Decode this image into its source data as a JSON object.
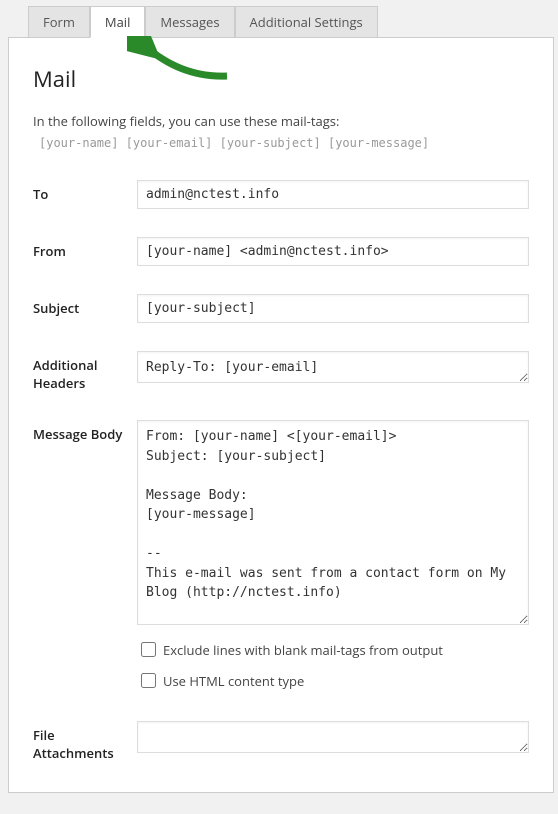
{
  "tabs": {
    "form": "Form",
    "mail": "Mail",
    "messages": "Messages",
    "additional": "Additional Settings"
  },
  "heading": "Mail",
  "intro": "In the following fields, you can use these mail-tags:",
  "mailtags": "[your-name] [your-email] [your-subject] [your-message]",
  "labels": {
    "to": "To",
    "from": "From",
    "subject": "Subject",
    "headers": "Additional Headers",
    "body": "Message Body",
    "attachments": "File Attachments"
  },
  "values": {
    "to": "admin@nctest.info",
    "from": "[your-name] <admin@nctest.info>",
    "subject": "[your-subject]",
    "headers": "Reply-To: [your-email]",
    "body": "From: [your-name] <[your-email]>\nSubject: [your-subject]\n\nMessage Body:\n[your-message]\n\n--\nThis e-mail was sent from a contact form on My Blog (http://nctest.info)",
    "attachments": ""
  },
  "checks": {
    "exclude": "Exclude lines with blank mail-tags from output",
    "html": "Use HTML content type"
  }
}
